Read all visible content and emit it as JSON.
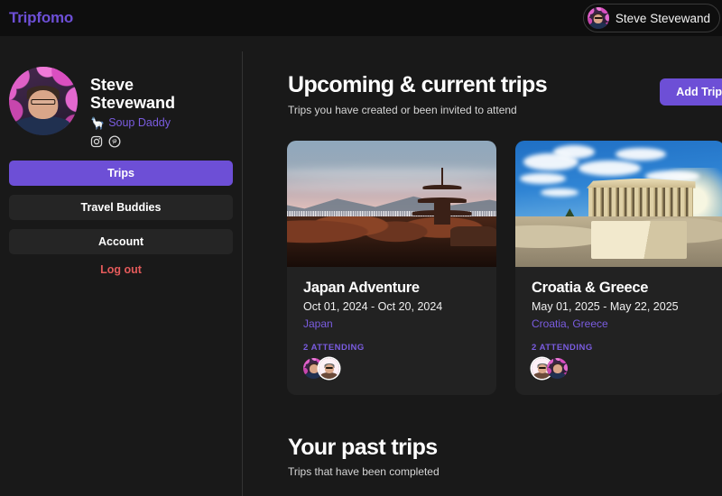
{
  "header": {
    "brand": "Tripfomo",
    "user_pill": {
      "name": "Steve Stevewand",
      "avatar": "user-avatar-flowers"
    }
  },
  "sidebar": {
    "profile": {
      "avatar": "profile-photo-flowers",
      "name_line1": "Steve",
      "name_line2": "Stevewand",
      "handle_icon": "sauropod-emoji",
      "handle": "Soup Daddy",
      "socials": [
        {
          "name": "instagram-icon",
          "label": "Instagram"
        },
        {
          "name": "pinterest-icon",
          "label": "Pinterest"
        }
      ]
    },
    "nav": [
      {
        "label": "Trips",
        "active": true
      },
      {
        "label": "Travel Buddies",
        "active": false
      },
      {
        "label": "Account",
        "active": false
      }
    ],
    "logout_label": "Log out"
  },
  "main": {
    "upcoming": {
      "title": "Upcoming & current trips",
      "subtitle": "Trips you have created or been invited to attend",
      "add_button": "Add Trip"
    },
    "trips": [
      {
        "image": "japan-pagoda-sunset-photo",
        "title": "Japan Adventure",
        "dates": "Oct 01, 2024 - Oct 20, 2024",
        "places": "Japan",
        "attending": "2 ATTENDING",
        "attendees": [
          "avatar-flowers",
          "avatar-pink-ring"
        ]
      },
      {
        "image": "greece-parthenon-photo",
        "title": "Croatia & Greece",
        "dates": "May 01, 2025 - May 22, 2025",
        "places": "Croatia, Greece",
        "attending": "2 ATTENDING",
        "attendees": [
          "avatar-pink-ring",
          "avatar-flowers"
        ]
      }
    ],
    "past": {
      "title": "Your past trips",
      "subtitle": "Trips that have been completed"
    }
  },
  "colors": {
    "accent": "#6d4fd6",
    "accent_text": "#7a5ce0",
    "danger": "#e35a5a",
    "header_bg": "#0e0e0e",
    "page_bg": "#191919",
    "card_bg": "#222222",
    "divider": "#333333"
  }
}
